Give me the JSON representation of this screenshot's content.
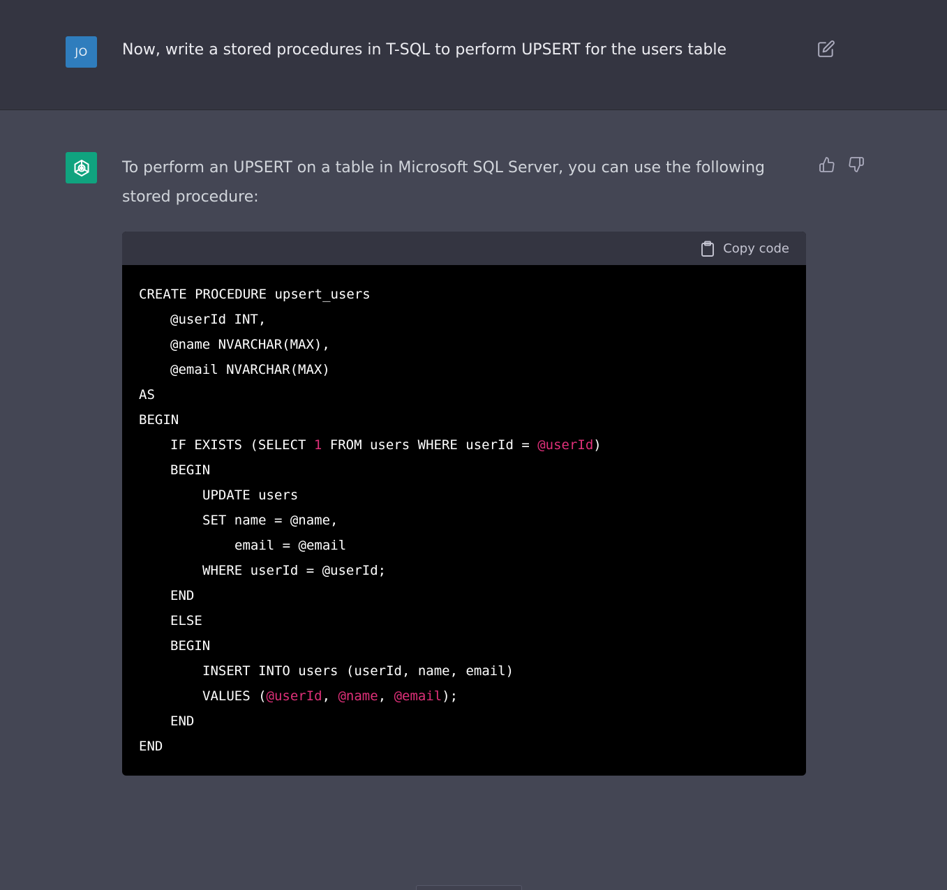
{
  "user_message": {
    "avatar_initials": "JO",
    "text": "Now, write a stored procedures in T-SQL to perform UPSERT for the users table",
    "edit_icon": "edit-icon"
  },
  "assistant_message": {
    "avatar_icon": "openai-logo-icon",
    "text": "To perform an UPSERT on a table in Microsoft SQL Server, you can use the following stored procedure:",
    "thumbs_up_icon": "thumbs-up-icon",
    "thumbs_down_icon": "thumbs-down-icon"
  },
  "code_block": {
    "copy_label": "Copy code",
    "copy_icon": "clipboard-icon",
    "lines": [
      {
        "indent": 0,
        "tokens": [
          {
            "t": "CREATE PROCEDURE upsert_users",
            "k": "plain"
          }
        ]
      },
      {
        "indent": 1,
        "tokens": [
          {
            "t": "@userId INT,",
            "k": "plain"
          }
        ]
      },
      {
        "indent": 1,
        "tokens": [
          {
            "t": "@name NVARCHAR(MAX),",
            "k": "plain"
          }
        ]
      },
      {
        "indent": 1,
        "tokens": [
          {
            "t": "@email NVARCHAR(MAX)",
            "k": "plain"
          }
        ]
      },
      {
        "indent": 0,
        "tokens": [
          {
            "t": "AS",
            "k": "plain"
          }
        ]
      },
      {
        "indent": 0,
        "tokens": [
          {
            "t": "BEGIN",
            "k": "plain"
          }
        ]
      },
      {
        "indent": 1,
        "tokens": [
          {
            "t": "IF EXISTS (SELECT ",
            "k": "plain"
          },
          {
            "t": "1",
            "k": "num"
          },
          {
            "t": " FROM users WHERE userId = ",
            "k": "plain"
          },
          {
            "t": "@userId",
            "k": "var"
          },
          {
            "t": ")",
            "k": "plain"
          }
        ]
      },
      {
        "indent": 1,
        "tokens": [
          {
            "t": "BEGIN",
            "k": "plain"
          }
        ]
      },
      {
        "indent": 2,
        "tokens": [
          {
            "t": "UPDATE users",
            "k": "plain"
          }
        ]
      },
      {
        "indent": 2,
        "tokens": [
          {
            "t": "SET name = @name,",
            "k": "plain"
          }
        ]
      },
      {
        "indent": 3,
        "tokens": [
          {
            "t": "email = @email",
            "k": "plain"
          }
        ]
      },
      {
        "indent": 2,
        "tokens": [
          {
            "t": "WHERE userId = @userId;",
            "k": "plain"
          }
        ]
      },
      {
        "indent": 1,
        "tokens": [
          {
            "t": "END",
            "k": "plain"
          }
        ]
      },
      {
        "indent": 1,
        "tokens": [
          {
            "t": "ELSE",
            "k": "plain"
          }
        ]
      },
      {
        "indent": 1,
        "tokens": [
          {
            "t": "BEGIN",
            "k": "plain"
          }
        ]
      },
      {
        "indent": 2,
        "tokens": [
          {
            "t": "INSERT INTO users (userId, name, email)",
            "k": "plain"
          }
        ]
      },
      {
        "indent": 2,
        "tokens": [
          {
            "t": "VALUES (",
            "k": "plain"
          },
          {
            "t": "@userId",
            "k": "var"
          },
          {
            "t": ", ",
            "k": "plain"
          },
          {
            "t": "@name",
            "k": "var"
          },
          {
            "t": ", ",
            "k": "plain"
          },
          {
            "t": "@email",
            "k": "var"
          },
          {
            "t": ");",
            "k": "plain"
          }
        ]
      },
      {
        "indent": 1,
        "tokens": [
          {
            "t": "END",
            "k": "plain"
          }
        ]
      },
      {
        "indent": 0,
        "tokens": [
          {
            "t": "END",
            "k": "plain"
          }
        ]
      }
    ]
  },
  "colors": {
    "user_bg": "#343541",
    "assistant_bg": "#444654",
    "user_avatar": "#2f7dbd",
    "bot_avatar": "#10a37f",
    "code_bg": "#000000",
    "code_header_bg": "#343541",
    "highlight": "#df3079"
  }
}
